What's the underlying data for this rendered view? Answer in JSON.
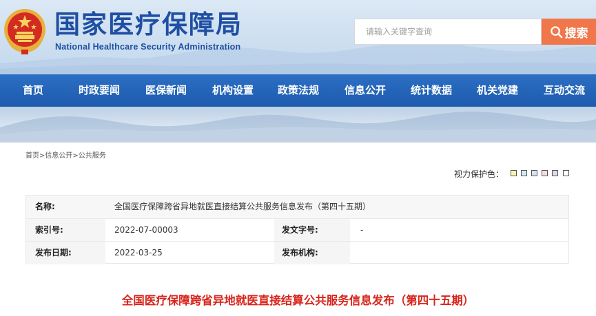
{
  "site": {
    "title_cn": "国家医疗保障局",
    "title_en": "National Healthcare Security Administration"
  },
  "search": {
    "placeholder": "请输入关键字查询",
    "button_label": "搜索",
    "accent_color": "#f0774a"
  },
  "nav": {
    "items": [
      {
        "label": "首页"
      },
      {
        "label": "时政要闻"
      },
      {
        "label": "医保新闻"
      },
      {
        "label": "机构设置"
      },
      {
        "label": "政策法规"
      },
      {
        "label": "信息公开"
      },
      {
        "label": "统计数据"
      },
      {
        "label": "机关党建"
      },
      {
        "label": "互动交流"
      }
    ],
    "color": "#1d5bad"
  },
  "breadcrumb": {
    "items": [
      "首页",
      "信息公开",
      "公共服务"
    ],
    "separator": ">"
  },
  "eye_care": {
    "label": "视力保护色：",
    "colors": [
      "#fbf3b7",
      "#d4ecf8",
      "#d6e1f6",
      "#f6dbe5",
      "#e3d7f4",
      "#ffffff"
    ]
  },
  "info": {
    "name_label": "名称:",
    "name_value": "全国医疗保障跨省异地就医直接结算公共服务信息发布（第四十五期）",
    "index_label": "索引号:",
    "index_value": "2022-07-00003",
    "doc_no_label": "发文字号:",
    "doc_no_value": "-",
    "date_label": "发布日期:",
    "date_value": "2022-03-25",
    "org_label": "发布机构:",
    "org_value": ""
  },
  "article": {
    "title": "全国医疗保障跨省异地就医直接结算公共服务信息发布（第四十五期）",
    "title_color": "#d8261d"
  }
}
